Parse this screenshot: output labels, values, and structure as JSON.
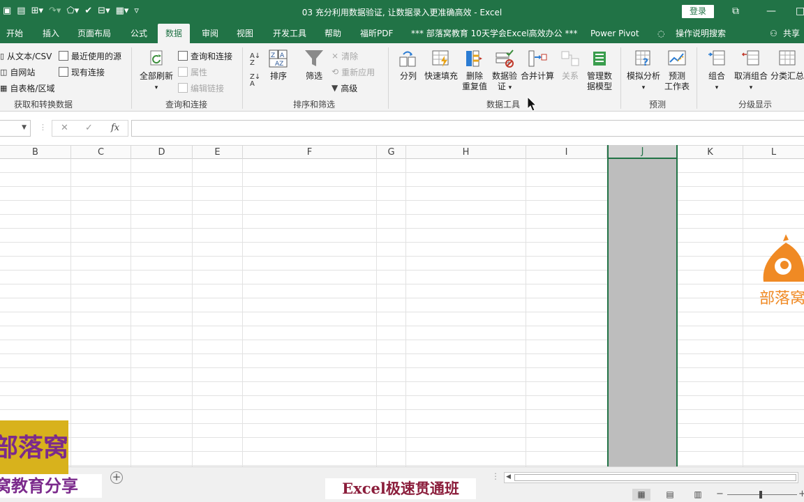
{
  "window": {
    "title": "03 充分利用数据验证, 让数据录入更准确高效  -  Excel",
    "login_label": "登录",
    "colors": {
      "brand": "#217346",
      "ribbon_bg": "#f3f3f3",
      "selection": "#bdbdbd"
    }
  },
  "tabs": [
    {
      "label": "开始"
    },
    {
      "label": "插入"
    },
    {
      "label": "页面布局"
    },
    {
      "label": "公式"
    },
    {
      "label": "数据",
      "active": true
    },
    {
      "label": "审阅"
    },
    {
      "label": "视图"
    },
    {
      "label": "开发工具"
    },
    {
      "label": "帮助"
    },
    {
      "label": "福昕PDF"
    },
    {
      "label": "*** 部落窝教育 10天学会Excel高效办公 ***"
    },
    {
      "label": "Power Pivot"
    },
    {
      "label": "操作说明搜索"
    },
    {
      "label": "共享"
    }
  ],
  "ribbon": {
    "get_data": {
      "label": "获取和转换数据",
      "from_text": "从文本/CSV",
      "from_web": "自网站",
      "from_table": "自表格/区域",
      "recent_sources": "最近使用的源",
      "existing_connections": "现有连接"
    },
    "queries": {
      "label": "查询和连接",
      "refresh_all": "全部刷新",
      "queries_connections": "查询和连接",
      "properties": "属性",
      "edit_links": "编辑链接"
    },
    "sort_filter": {
      "label": "排序和筛选",
      "sort": "排序",
      "filter": "筛选",
      "clear": "清除",
      "reapply": "重新应用",
      "advanced": "高级"
    },
    "data_tools": {
      "label": "数据工具",
      "text_to_columns": "分列",
      "flash_fill": "快速填充",
      "remove_dup_1": "删除",
      "remove_dup_2": "重复值",
      "validation_1": "数据验",
      "validation_2": "证",
      "consolidate": "合并计算",
      "relationships": "关系",
      "data_model_1": "管理数",
      "data_model_2": "据模型"
    },
    "forecast": {
      "label": "预测",
      "what_if": "模拟分析",
      "forecast_1": "预测",
      "forecast_2": "工作表"
    },
    "outline": {
      "label": "分级显示",
      "group": "组合",
      "ungroup": "取消组合",
      "subtotal": "分类汇总"
    }
  },
  "formula_bar": {
    "fx": "fx",
    "cancel": "✕",
    "enter": "✓"
  },
  "columns": [
    "B",
    "C",
    "D",
    "E",
    "F",
    "G",
    "H",
    "I",
    "J",
    "K",
    "L"
  ],
  "selected_column": "J",
  "watermarks": {
    "logo_text": "部落窝",
    "left_big": "部落窝",
    "left_sub": "窝教育分享",
    "bottom": "Excel极速贯通班"
  }
}
